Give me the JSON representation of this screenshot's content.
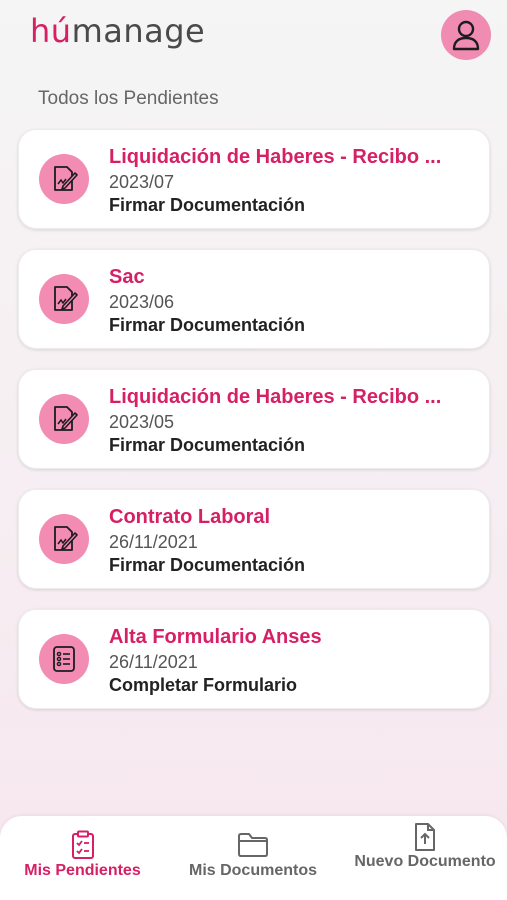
{
  "app": {
    "logo_hu": "hú",
    "logo_rest": "manage"
  },
  "header": {
    "avatar_icon": "user-icon"
  },
  "section_title": "Todos los Pendientes",
  "pending": [
    {
      "title": "Liquidación de Haberes - Recibo ...",
      "date": "2023/07",
      "action": "Firmar Documentación",
      "icon": "sign-document-icon"
    },
    {
      "title": "Sac",
      "date": "2023/06",
      "action": "Firmar Documentación",
      "icon": "sign-document-icon"
    },
    {
      "title": "Liquidación de Haberes - Recibo ...",
      "date": "2023/05",
      "action": "Firmar Documentación",
      "icon": "sign-document-icon"
    },
    {
      "title": "Contrato Laboral",
      "date": "26/11/2021",
      "action": "Firmar Documentación",
      "icon": "sign-document-icon"
    },
    {
      "title": "Alta Formulario Anses",
      "date": "26/11/2021",
      "action": "Completar Formulario",
      "icon": "form-checklist-icon"
    }
  ],
  "bottom_nav": {
    "items": [
      {
        "label": "Mis Pendientes",
        "icon": "clipboard-check-icon",
        "active": true
      },
      {
        "label": "Mis Documentos",
        "icon": "folder-icon",
        "active": false
      },
      {
        "label": "Nuevo Documento",
        "icon": "file-upload-icon",
        "active": false
      }
    ]
  },
  "colors": {
    "brand": "#d61f64",
    "icon_bg": "#f28cb3",
    "inactive": "#666666"
  }
}
